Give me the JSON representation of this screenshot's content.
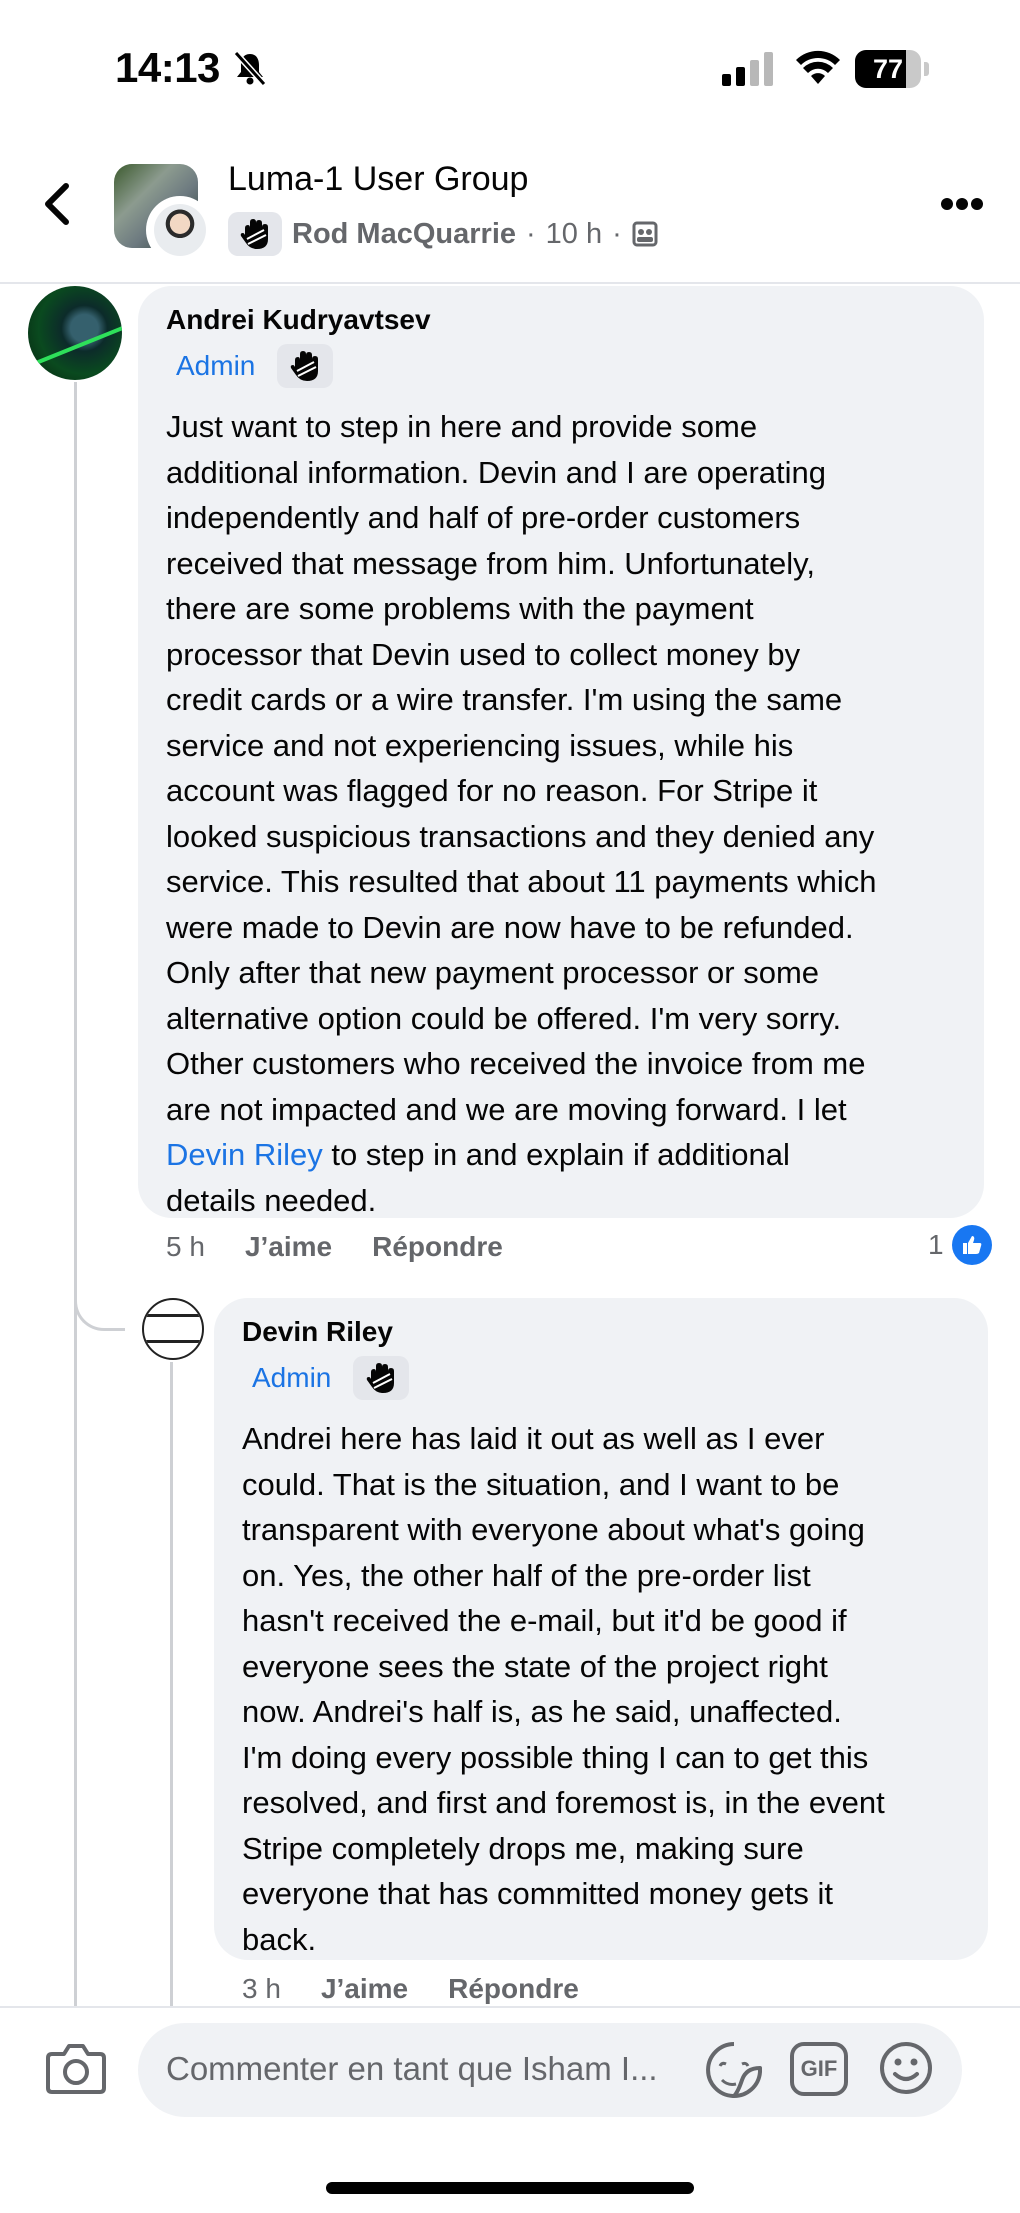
{
  "status_bar": {
    "time": "14:13",
    "battery": "77",
    "battery_level": 0.77
  },
  "header": {
    "group_name": "Luma-1 User Group",
    "poster_name": "Rod MacQuarrie",
    "separator": "·",
    "time_ago": "10 h",
    "separator2": "·",
    "icons": [
      "back-chevron-icon",
      "group-privacy-icon",
      "more-icon",
      "wave-icon"
    ]
  },
  "comments": [
    {
      "author": "Andrei Kudryavtsev",
      "badge": "Admin",
      "lines": [
        "Just want to step in here and provide some",
        "additional information. Devin and I are operating",
        "independently and half of pre-order customers",
        "received that message from him. Unfortunately,",
        "there are some problems with the payment",
        "processor that Devin used to collect money by",
        "credit cards or a wire transfer. I'm using the same",
        "service and not experiencing issues, while his",
        "account was flagged for no reason. For Stripe it",
        "looked suspicious transactions and they denied any",
        "service. This resulted that about 11 payments which",
        "were made to Devin are now have to be refunded.",
        "Only after that new payment processor or some",
        "alternative option could be offered. I'm very sorry.",
        "Other customers who received the invoice from me",
        "are not impacted and we are moving forward. I let"
      ],
      "mention": "Devin Riley",
      "mention_tail": " to step in and explain if additional",
      "last_line": "details needed.",
      "time": "5 h",
      "like_label": "J’aime",
      "reply_label": "Répondre",
      "like_count": "1"
    },
    {
      "author": "Devin Riley",
      "badge": "Admin",
      "lines": [
        "Andrei here has laid it out as well as I ever",
        "could. That is the situation, and I want to be",
        "transparent with everyone about what's going",
        "on. Yes, the other half of the pre-order list",
        "hasn't received the e-mail, but it'd be good if",
        "everyone sees the state of the project right",
        "now. Andrei's half is, as he said, unaffected.",
        "I'm doing every possible thing I can to get this",
        "resolved, and first and foremost is, in the event",
        "Stripe completely drops me, making sure",
        "everyone that has committed money gets it",
        "back."
      ],
      "time": "3 h",
      "like_label": "J’aime",
      "reply_label": "Répondre"
    }
  ],
  "composer": {
    "placeholder": "Commenter en tant que Isham I...",
    "gif_label": "GIF",
    "icons": [
      "camera-icon",
      "sticker-icon",
      "gif-icon",
      "emoji-icon"
    ]
  },
  "colors": {
    "accent": "#1877f2",
    "link": "#1b74e4",
    "bubble": "#f0f2f5",
    "meta": "#65676b"
  }
}
